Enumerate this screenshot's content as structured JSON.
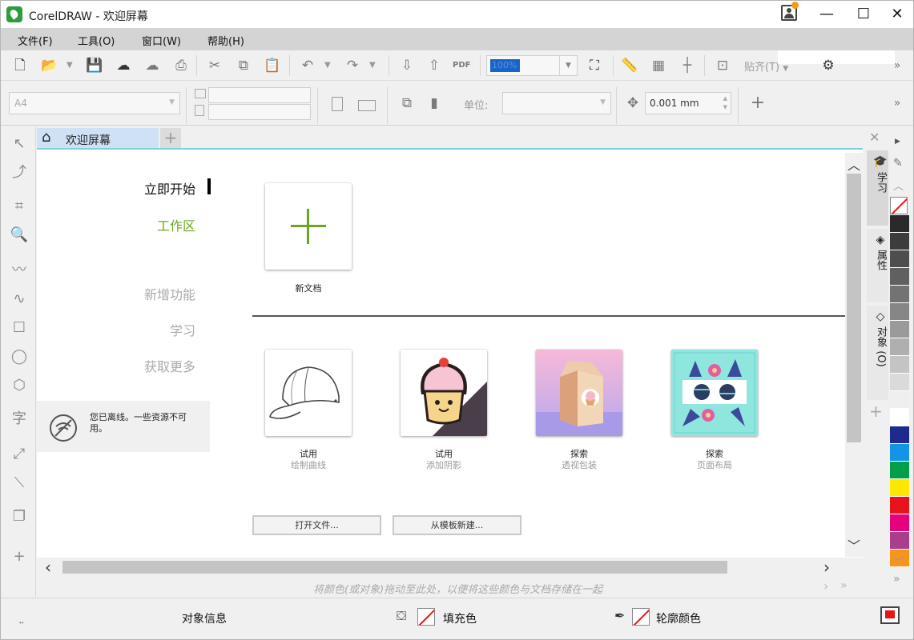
{
  "window": {
    "title": "CorelDRAW - 欢迎屏幕",
    "controls": {
      "minimize": "—",
      "maximize": "☐",
      "close": "✕"
    }
  },
  "menu": [
    "文件(F)",
    "工具(O)",
    "窗口(W)",
    "帮助(H)"
  ],
  "toolbar": {
    "zoom_value": "100%",
    "snap_label": "贴齐(T)",
    "overflow": "»",
    "pdf_label": "PDF"
  },
  "propertybar": {
    "page_size": "A4",
    "units_label": "单位:",
    "units_value": "",
    "nudge_value": "0.001 mm"
  },
  "tabs": {
    "welcome": "欢迎屏幕",
    "add": "+"
  },
  "welcome_nav": {
    "items": [
      "立即开始",
      "工作区",
      "新增功能",
      "学习",
      "获取更多"
    ],
    "offline_message": "您已离线。一些资源不可用。"
  },
  "new_document": {
    "label": "新文档"
  },
  "cards": [
    {
      "title": "试用",
      "subtitle": "绘制曲线",
      "icon": "baseball-cap-image"
    },
    {
      "title": "试用",
      "subtitle": "添加阴影",
      "icon": "cupcake-image"
    },
    {
      "title": "探索",
      "subtitle": "透视包装",
      "icon": "milk-carton-image"
    },
    {
      "title": "探索",
      "subtitle": "页面布局",
      "icon": "sunglasses-image"
    }
  ],
  "buttons": {
    "open_file": "打开文件...",
    "from_template": "从模板新建..."
  },
  "docker_tabs": [
    "学习",
    "属性",
    "对象 (O)"
  ],
  "document_palette_hint": "将颜色(或对象)拖动至此处，以便将这些颜色与文档存储在一起",
  "status": {
    "object_info": "对象信息",
    "fill_color": "填充色",
    "outline_color": "轮廓颜色"
  },
  "palette_colors": [
    "#2a2a2a",
    "#3c3c3c",
    "#4e4e4e",
    "#606060",
    "#737373",
    "#868686",
    "#9a9a9a",
    "#afafaf",
    "#c4c4c4",
    "#dadada",
    "#efefef",
    "#ffffff",
    "#1f2a8f",
    "#1593e6",
    "#00a04a",
    "#ffe800",
    "#e8141c",
    "#e6007e",
    "#a93e8a",
    "#f7941d"
  ],
  "colors": {
    "accent_green": "#6aa51f",
    "tab_active": "#cfe1f5",
    "tab_underline": "#7fd0dc",
    "zoom_highlight": "#1a64c8"
  }
}
